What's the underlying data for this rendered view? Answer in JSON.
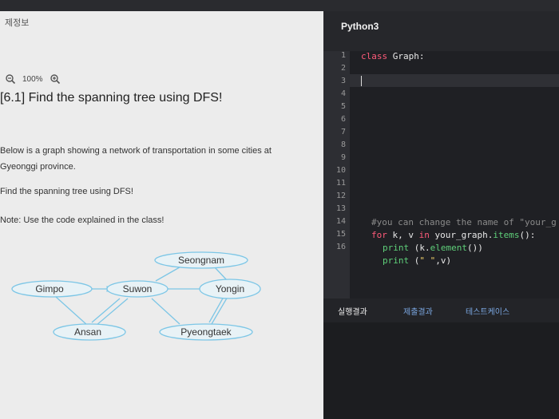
{
  "left_panel": {
    "tab_label": "제정보",
    "zoom_level": "100%",
    "title": "[6.1] Find the spanning tree using DFS!",
    "paragraph1": "Below is a graph showing a network of transportation in some cities at Gyeonggi province.",
    "paragraph2": "Find the spanning tree using DFS!",
    "paragraph3": "Note: Use the code explained in the class!"
  },
  "graph": {
    "nodes": [
      "Seongnam",
      "Gimpo",
      "Suwon",
      "Yongin",
      "Ansan",
      "Pyeongtaek"
    ]
  },
  "editor": {
    "language": "Python3",
    "line_numbers": [
      "1",
      "2",
      "3",
      "4",
      "5",
      "6",
      "7",
      "8",
      "9",
      "10",
      "11",
      "12",
      "13",
      "14",
      "15",
      "16"
    ],
    "line1_kw": "class",
    "line1_name": "Graph:",
    "line13_comment": "#you can change the name of \"your_g",
    "line14_for": "for",
    "line14_vars": " k, v ",
    "line14_in": "in",
    "line14_rest": " your_graph.",
    "line14_fn": "items",
    "line14_end": "():",
    "line15_print": "print",
    "line15_rest": " (k.",
    "line15_fn": "element",
    "line15_end": "())",
    "line16_print": "print",
    "line16_open": " (",
    "line16_str": "\" \"",
    "line16_end": ",v)"
  },
  "output_tabs": [
    "실행결과",
    "제출결과",
    "테스트케이스"
  ],
  "colors": {
    "keyword": "#ff5b7a",
    "function": "#5fd07a",
    "string": "#f0d06a",
    "node_border": "#7cc6e6"
  }
}
